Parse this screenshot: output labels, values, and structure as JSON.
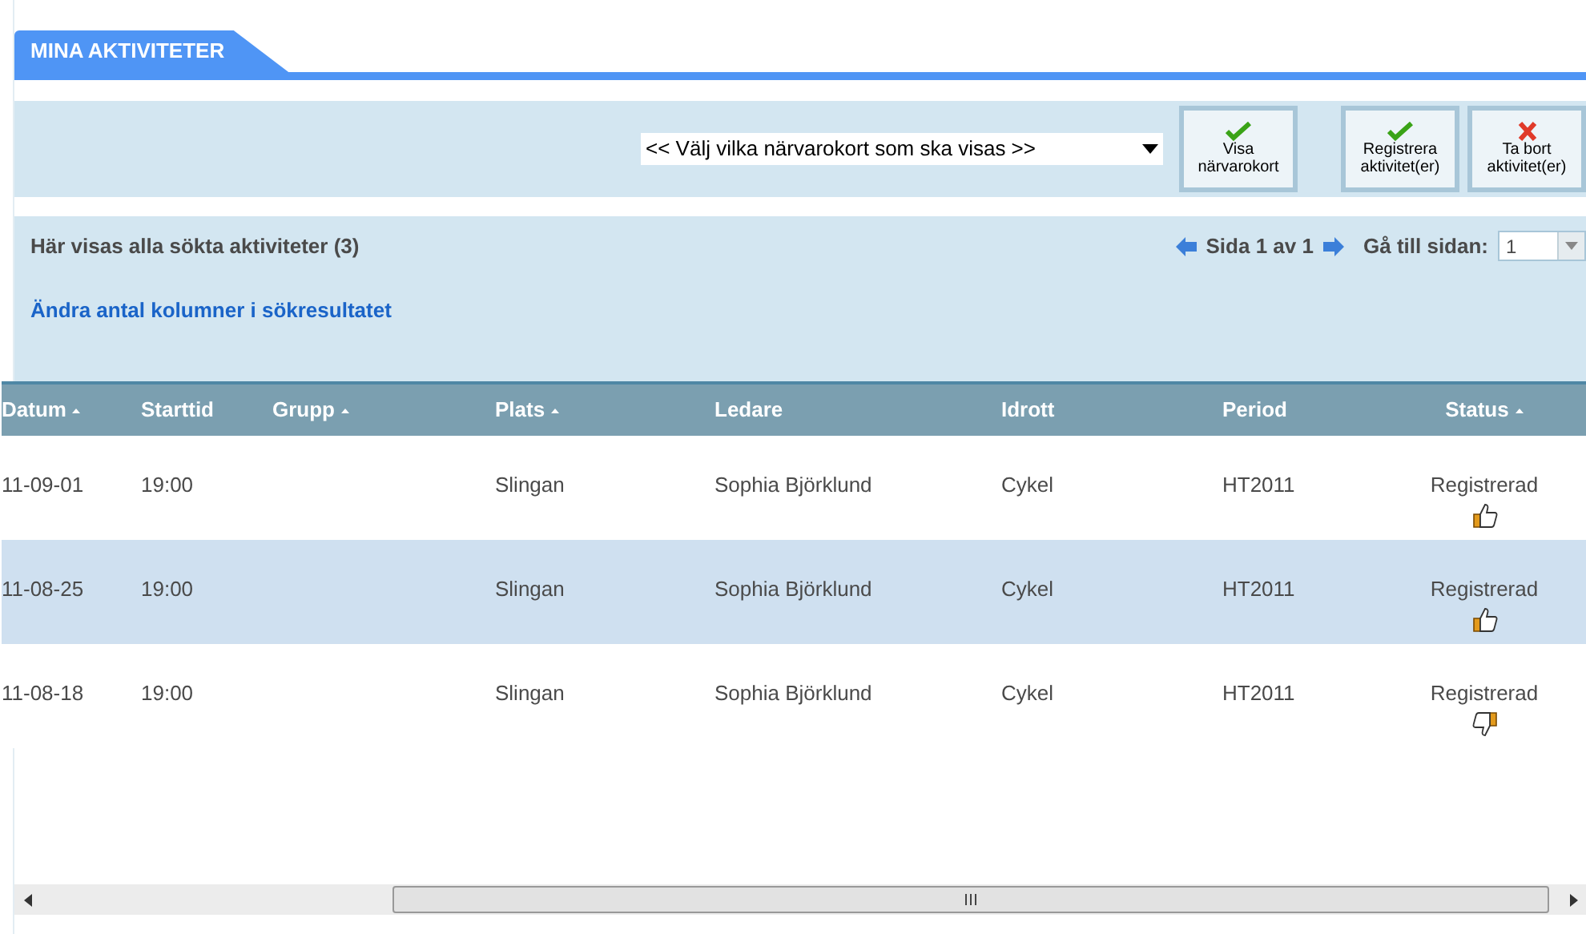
{
  "tab": {
    "title": "MINA AKTIVITETER"
  },
  "toolbar": {
    "select": {
      "value": "<< Välj vilka närvarokort som ska visas >>"
    },
    "buttons": [
      {
        "label": "Visa närvarokort",
        "kind": "check"
      },
      {
        "label": "Registrera aktivitet(er)",
        "kind": "check"
      },
      {
        "label": "Ta bort aktivitet(er)",
        "kind": "cross"
      }
    ]
  },
  "info": {
    "summary": "Här visas alla sökta aktiviteter (3)",
    "link": "Ändra antal kolumner i sökresultatet",
    "pager": "Sida 1 av 1",
    "goto_label": "Gå till sidan:",
    "goto_value": "1"
  },
  "table": {
    "columns": [
      {
        "label": "Datum",
        "sortable": true
      },
      {
        "label": "Starttid",
        "sortable": false
      },
      {
        "label": "Grupp",
        "sortable": true
      },
      {
        "label": "Plats",
        "sortable": true
      },
      {
        "label": "Ledare",
        "sortable": false
      },
      {
        "label": "Idrott",
        "sortable": false
      },
      {
        "label": "Period",
        "sortable": false
      },
      {
        "label": "Status",
        "sortable": true
      }
    ],
    "rows": [
      {
        "cells": [
          "11-09-01",
          "19:00",
          "",
          "Slingan",
          "Sophia Björklund",
          "Cykel",
          "HT2011",
          "Registrerad"
        ],
        "thumbs_up": true,
        "selected": false
      },
      {
        "cells": [
          "11-08-25",
          "19:00",
          "",
          "Slingan",
          "Sophia Björklund",
          "Cykel",
          "HT2011",
          "Registrerad"
        ],
        "thumbs_up": true,
        "selected": true
      },
      {
        "cells": [
          "11-08-18",
          "19:00",
          "",
          "Slingan",
          "Sophia Björklund",
          "Cykel",
          "HT2011",
          "Registrerad"
        ],
        "thumbs_up": false,
        "selected": false
      }
    ]
  }
}
